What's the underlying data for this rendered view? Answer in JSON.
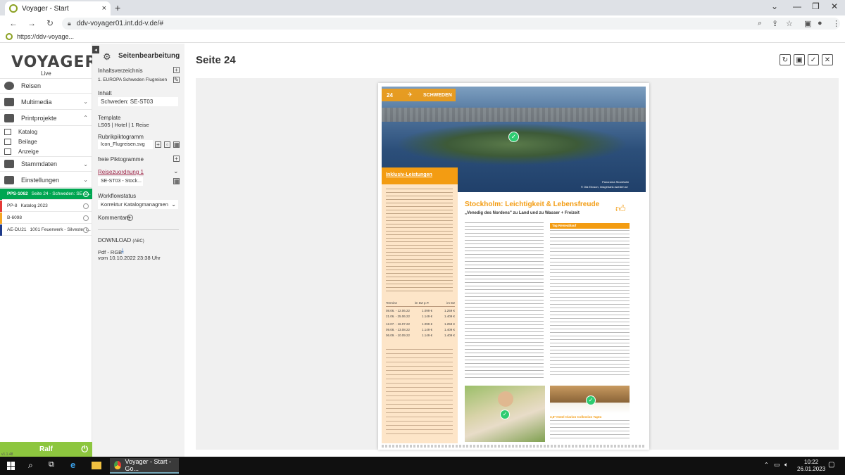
{
  "browser": {
    "tab_title": "Voyager - Start",
    "tab_close": "×",
    "new_tab": "+",
    "url": "ddv-voyager01.int.dd-v.de/#",
    "bookmark": "https://ddv-voyage..."
  },
  "brand": {
    "logo": "VOYAGER",
    "sub": "Live",
    "accent": "#8dc63f"
  },
  "sidebar": {
    "menu": [
      {
        "label": "Reisen"
      },
      {
        "label": "Multimedia"
      },
      {
        "label": "Printprojekte"
      },
      {
        "label": "Stammdaten"
      },
      {
        "label": "Einstellungen"
      }
    ],
    "print_items": [
      "Katalog",
      "Beilage",
      "Anzeige"
    ],
    "projects": [
      {
        "code": "PPS-1062",
        "title": "Seite 24 - Schweden: SE-S...",
        "color": "#00a651"
      },
      {
        "code": "PP-8",
        "title": "Katalog 2023",
        "color": "#e53935"
      },
      {
        "code": "B-6098",
        "title": "",
        "color": "#f5a623"
      },
      {
        "code": "AE-DU21",
        "title": "1001 Feuerwerk - Silvester i...",
        "color": "#1e3a8a"
      }
    ],
    "user": "Ralf",
    "version": "v1.1.48"
  },
  "editor": {
    "title": "Seitenbearbeitung",
    "toc_label": "Inhaltsverzeichnis",
    "toc_item": "1.  EUROPA Schweden Flugreisen",
    "content_label": "Inhalt",
    "content_value": "Schweden: SE-ST03",
    "template_label": "Template",
    "template_value": "LS05 | Hotel | 1 Reise",
    "rubric_label": "Rubrikpiktogramm",
    "rubric_value": "Icon_Flugreisen.svg",
    "free_label": "freie Piktogramme",
    "travel_label": "Reisezuordnung 1",
    "travel_value": "SE-ST03 - Stock...",
    "workflow_label": "Workflowstatus",
    "workflow_value": "Korrektur Katalogmanagmen",
    "comments_label": "Kommentare",
    "download_label": "DOWNLOAD",
    "download_abc": "(ABC)",
    "pdf_label": "Pdf - RGB",
    "pdf_date": "vom 10.10.2022 23:38 Uhr"
  },
  "main": {
    "page_title": "Seite 24"
  },
  "catalog": {
    "page_no": "24",
    "country": "SCHWEDEN",
    "photo_caption": "Panorama Stockholm",
    "photo_credit": "© Ola Ericson, imagebank.sweden.se",
    "inclusive_title": "Inklusiv-Leistungen",
    "headline": "Stockholm: Leichtigkeit & Lebensfreude",
    "subheadline": "„Venedig des Nordens\" zu Land und zu Wasser + Freizeit",
    "itinerary_header": "Tag  Reiseablauf",
    "hotel_caption": "3,5* Hotel Clarion Collection Tapto",
    "prices": {
      "header": [
        "Termine",
        "im DZ p.P.",
        "im EZ"
      ],
      "rows": [
        [
          "08.06. - 12.06.22",
          "1.099 €",
          "1.259 €"
        ],
        [
          "21.06. - 25.06.22",
          "1.149 €",
          "1.409 €"
        ],
        [
          "12.07. - 16.07.22",
          "1.099 €",
          "1.259 €"
        ],
        [
          "09.08. - 13.08.22",
          "1.149 €",
          "1.409 €"
        ],
        [
          "06.09. - 10.09.22",
          "1.149 €",
          "1.409 €"
        ]
      ]
    }
  },
  "taskbar": {
    "chrome_label": "Voyager - Start - Go...",
    "time": "10:22",
    "date": "26.01.2023"
  }
}
